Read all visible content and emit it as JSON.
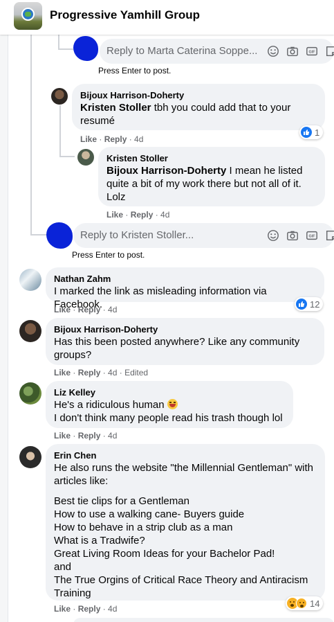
{
  "header": {
    "group_name": "Progressive Yamhill Group"
  },
  "reply_boxes": [
    {
      "placeholder": "Reply to Marta Caterina Soppe...",
      "hint": "Press Enter to post."
    },
    {
      "placeholder": "Reply to Kristen Stoller...",
      "hint": "Press Enter to post."
    }
  ],
  "comments": [
    {
      "author": "Bijoux Harrison-Doherty",
      "mention": "Kristen Stoller",
      "text": " tbh you could add that to your resumé",
      "like": "Like",
      "reply": "Reply",
      "time": "4d",
      "reaction_count": "1"
    },
    {
      "author": "Kristen Stoller",
      "mention": "Bijoux Harrison-Doherty",
      "text": " I mean he listed quite a bit of my work there but not all of it. Lolz",
      "like": "Like",
      "reply": "Reply",
      "time": "4d"
    },
    {
      "author": "Nathan Zahm",
      "text": "I marked the link as misleading information via Facebook.",
      "like": "Like",
      "reply": "Reply",
      "time": "4d",
      "reaction_count": "12"
    },
    {
      "author": "Bijoux Harrison-Doherty",
      "text": "Has this been posted anywhere? Like any community groups?",
      "like": "Like",
      "reply": "Reply",
      "time": "4d",
      "edited": "Edited"
    },
    {
      "author": "Liz Kelley",
      "line1": "He's a ridiculous human",
      "line2": "I don't think many people read his trash though lol",
      "like": "Like",
      "reply": "Reply",
      "time": "4d"
    },
    {
      "author": "Erin Chen",
      "intro": "He also runs the website \"the Millennial Gentleman\" with articles like:",
      "articles": [
        "Best tie clips for a Gentleman",
        "How to use a walking cane- Buyers guide",
        "How to behave in a strip club as a man",
        "What is a Tradwife?",
        "Great Living Room Ideas for your Bachelor Pad!",
        "and",
        "The True Orgins of Critical Race Theory and Antiracism Training"
      ],
      "like": "Like",
      "reply": "Reply",
      "time": "4d",
      "reaction_count": "14"
    }
  ],
  "icons": [
    "emoji-icon",
    "camera-icon",
    "gif-icon",
    "sticker-icon",
    "like-icon",
    "haha-icon",
    "wow-icon"
  ],
  "colors": {
    "bubble": "#f0f2f5",
    "link_blue": "#1877f2",
    "meta_gray": "#65676b",
    "scribble": "#0a23d8"
  }
}
